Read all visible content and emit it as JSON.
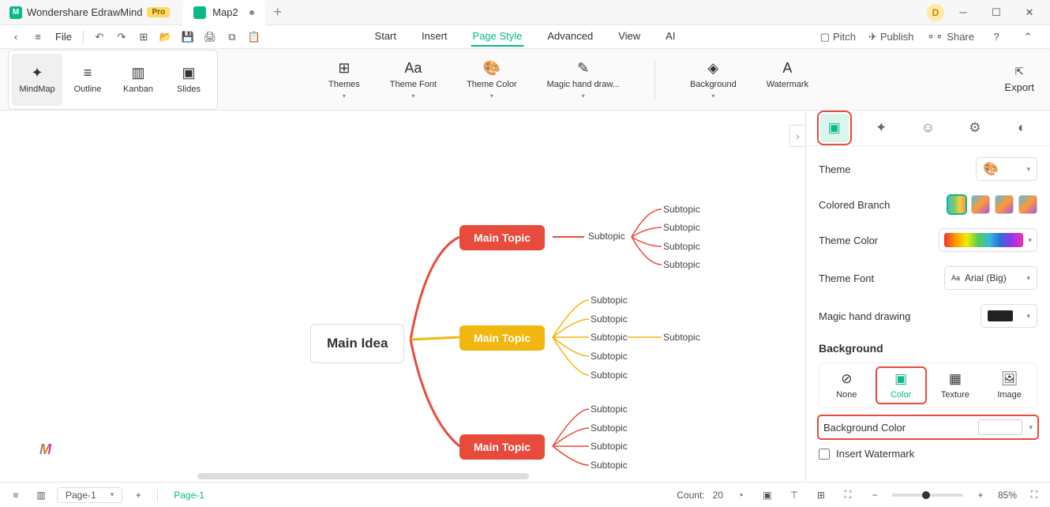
{
  "app": {
    "name": "Wondershare EdrawMind",
    "badge": "Pro",
    "avatar": "D"
  },
  "doc": {
    "name": "Map2"
  },
  "menu": {
    "file": "File",
    "tabs": [
      "Start",
      "Insert",
      "Page Style",
      "Advanced",
      "View",
      "AI"
    ],
    "active": 2
  },
  "top_right": {
    "pitch": "Pitch",
    "publish": "Publish",
    "share": "Share"
  },
  "views": [
    "MindMap",
    "Outline",
    "Kanban",
    "Slides"
  ],
  "ribbon": {
    "themes": "Themes",
    "theme_font": "Theme Font",
    "theme_color": "Theme Color",
    "magic": "Magic hand draw...",
    "background": "Background",
    "watermark": "Watermark",
    "export": "Export"
  },
  "mindmap": {
    "main": "Main Idea",
    "topics": [
      "Main Topic",
      "Main Topic",
      "Main Topic"
    ],
    "subtopic": "Subtopic"
  },
  "panel": {
    "theme": "Theme",
    "colored_branch": "Colored Branch",
    "theme_color": "Theme Color",
    "theme_font": "Theme Font",
    "theme_font_value": "Arial (Big)",
    "magic_hand": "Magic hand drawing",
    "bg_title": "Background",
    "bg_opts": [
      "None",
      "Color",
      "Texture",
      "Image"
    ],
    "bg_color": "Background Color",
    "insert_wm": "Insert Watermark"
  },
  "status": {
    "page_sel": "Page-1",
    "page_tab": "Page-1",
    "count_label": "Count:",
    "count": "20",
    "zoom": "85%"
  }
}
